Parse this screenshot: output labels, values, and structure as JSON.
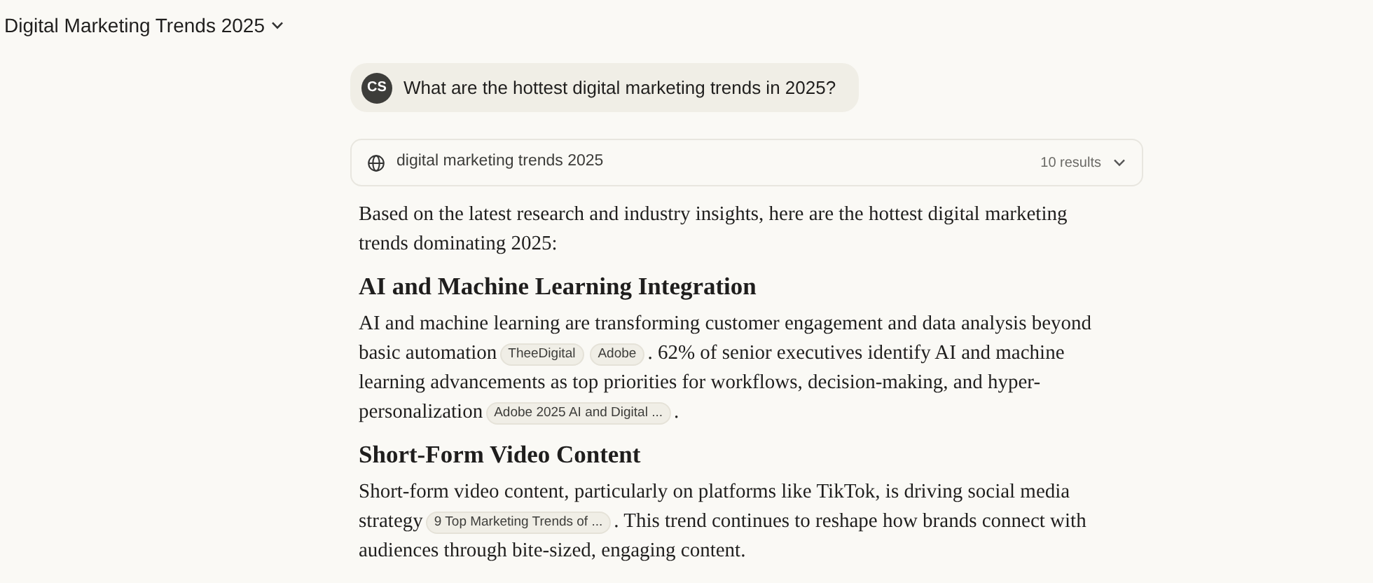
{
  "conversation_title": "Digital Marketing Trends 2025",
  "user_message": {
    "avatar": "CS",
    "text": "What are the hottest digital marketing trends in 2025?"
  },
  "search": {
    "query": "digital marketing trends 2025",
    "results": "10 results",
    "expanded": false
  },
  "content": [
    {
      "kind": "paragraph",
      "segments": [
        {
          "kind": "text",
          "text": "Based on the latest research and industry insights, here are the hottest digital marketing trends dominating 2025:"
        }
      ]
    },
    {
      "kind": "heading",
      "text": "AI and Machine Learning Integration"
    },
    {
      "kind": "paragraph",
      "segments": [
        {
          "kind": "text",
          "text": "AI and machine learning are transforming customer engagement and data analysis beyond basic automation"
        },
        {
          "kind": "citation",
          "text": "TheeDigital"
        },
        {
          "kind": "citation",
          "text": "Adobe"
        },
        {
          "kind": "text",
          "text": ". 62% of senior executives identify AI and machine learning advancements as top priorities for workflows, decision-making, and hyper-personalization"
        },
        {
          "kind": "citation",
          "text": "Adobe 2025 AI and Digital ..."
        },
        {
          "kind": "text",
          "text": "."
        }
      ]
    },
    {
      "kind": "heading",
      "text": "Short-Form Video Content"
    },
    {
      "kind": "paragraph",
      "segments": [
        {
          "kind": "text",
          "text": "Short-form video content, particularly on platforms like TikTok, is driving social media strategy"
        },
        {
          "kind": "citation",
          "text": "9 Top Marketing Trends of ..."
        },
        {
          "kind": "text",
          "text": ". This trend continues to reshape how brands connect with audiences through bite-sized, engaging content."
        }
      ]
    }
  ]
}
